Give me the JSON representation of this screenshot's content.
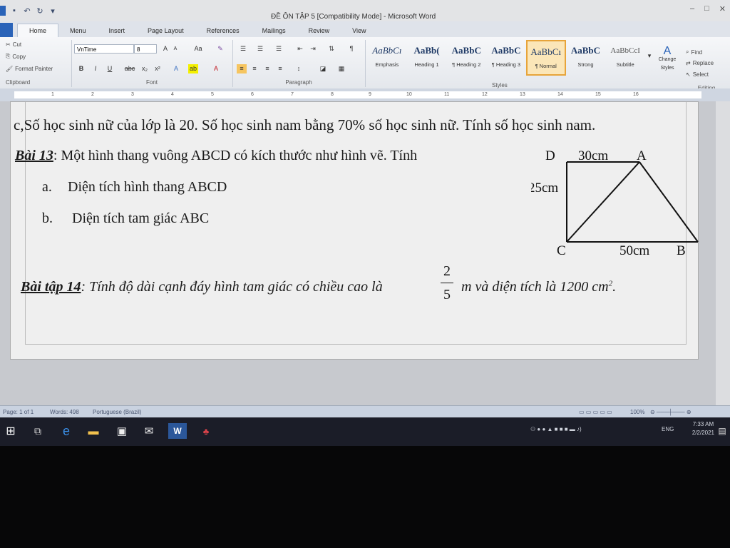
{
  "window": {
    "title": "ĐỀ ÔN TẬP 5 [Compatibility Mode] - Microsoft Word"
  },
  "tabs": [
    "Home",
    "Menu",
    "Insert",
    "Page Layout",
    "References",
    "Mailings",
    "Review",
    "View"
  ],
  "ribbon": {
    "clipboard": {
      "cut": "Cut",
      "copy": "Copy",
      "format_painter": "Format Painter",
      "label": "Clipboard"
    },
    "font": {
      "name": "VnTime",
      "size": "8",
      "label": "Font"
    },
    "paragraph": {
      "label": "Paragraph"
    },
    "styles": {
      "label": "Styles",
      "items": [
        {
          "preview": "AaBbCı",
          "name": "Emphasis"
        },
        {
          "preview": "AaBb(",
          "name": "Heading 1"
        },
        {
          "preview": "AaBbC",
          "name": "¶ Heading 2"
        },
        {
          "preview": "AaBbC",
          "name": "¶ Heading 3"
        },
        {
          "preview": "AaBbCı",
          "name": "¶ Normal"
        },
        {
          "preview": "AaBbC",
          "name": "Strong"
        },
        {
          "preview": "AaBbCcI",
          "name": "Subtitle"
        }
      ],
      "change_styles": "Change Styles"
    },
    "editing": {
      "find": "Find",
      "replace": "Replace",
      "select": "Select",
      "label": "Editing"
    }
  },
  "ruler": {
    "ticks": [
      "1",
      "2",
      "3",
      "4",
      "5",
      "6",
      "7",
      "8",
      "9",
      "10",
      "11",
      "12",
      "13",
      "14",
      "15",
      "16"
    ]
  },
  "document": {
    "line_c": "c,Số học sinh nữ của lớp là 20. Số học sinh nam bằng 70% số học sinh nữ.  Tính số học sinh nam.",
    "bai13_label": "Bài 13",
    "bai13_text": ":  Một hình thang vuông ABCD có kích thước như hình vẽ. Tính",
    "item_a_marker": "a.",
    "item_a_text": "Diện tích hình thang ABCD",
    "item_b_marker": "b.",
    "item_b_text": "Diện tích tam giác ABC",
    "bai14_label": "Bài tập 14",
    "bai14_text": ": Tính độ dài cạnh đáy hình tam giác có chiều cao là",
    "bai14_frac_num": "2",
    "bai14_frac_den": "5",
    "bai14_text_after": "m và diện tích là 1200 cm",
    "bai14_sup": "2",
    "bai14_end": ".",
    "figure": {
      "D": "D",
      "A": "A",
      "C": "C",
      "B": "B",
      "top_len": "30cm",
      "side_len": "25cm",
      "bottom_len": "50cm"
    }
  },
  "status": {
    "page": "Page: 1 of 1",
    "words": "Words: 498",
    "language": "Portuguese (Brazil)",
    "zoom": "100%"
  },
  "taskbar": {
    "lang": "ENG",
    "time": "7:33 AM",
    "date": "2/2/2021"
  }
}
